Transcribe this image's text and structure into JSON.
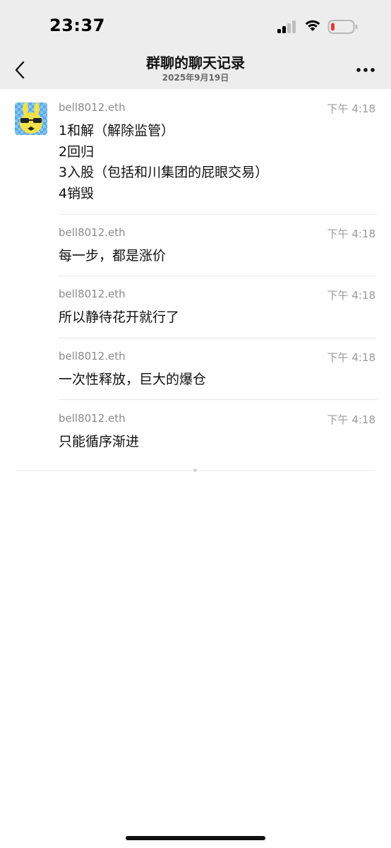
{
  "status_bar": {
    "time": "23:37",
    "icons": [
      "signal-icon",
      "wifi-icon",
      "battery-low-icon"
    ],
    "battery_color": "#e53935"
  },
  "nav": {
    "title": "群聊的聊天记录",
    "subtitle": "2025年9月19日",
    "back_icon": "chevron-left-icon",
    "more_icon": "more-dots-icon"
  },
  "messages": [
    {
      "sender": "bell8012.eth",
      "time": "下午 4:18",
      "lines": [
        "1和解（解除监管）",
        "2回归",
        "3入股（包括和川集团的屁眼交易）",
        "4销毁"
      ]
    },
    {
      "sender": "bell8012.eth",
      "time": "下午 4:18",
      "lines": [
        "每一步，都是涨价"
      ]
    },
    {
      "sender": "bell8012.eth",
      "time": "下午 4:18",
      "lines": [
        "所以静待花开就行了"
      ]
    },
    {
      "sender": "bell8012.eth",
      "time": "下午 4:18",
      "lines": [
        "一次性释放，巨大的爆仓"
      ]
    },
    {
      "sender": "bell8012.eth",
      "time": "下午 4:18",
      "lines": [
        "只能循序渐进"
      ]
    }
  ],
  "colors": {
    "header_bg": "#ededed",
    "avatar_bg": "#5aa9e6",
    "avatar_character": "#f2e24a"
  }
}
